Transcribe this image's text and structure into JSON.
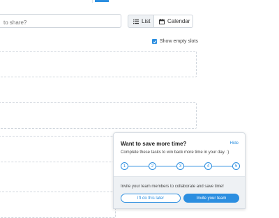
{
  "header": {
    "share_placeholder": "to share?"
  },
  "view_toggle": {
    "list_label": "List",
    "calendar_label": "Calendar",
    "list_icon": "list-icon",
    "calendar_icon": "calendar-icon"
  },
  "options": {
    "show_empty_slots_label": "Show empty slots",
    "show_empty_slots_checked": true
  },
  "tip": {
    "title": "Want to save more time?",
    "hide_label": "Hide",
    "description": "Complete these tasks to win back more time in your day. :)",
    "steps": [
      "1",
      "2",
      "3",
      "4",
      "5"
    ],
    "invite_text": "Invite your team members to collaborate and save time!",
    "later_label": "I'll do this later",
    "invite_label": "Invite your team"
  },
  "colors": {
    "accent": "#2b8ee0",
    "border": "#cfd5dc",
    "footer_bg": "#eef1f4"
  }
}
